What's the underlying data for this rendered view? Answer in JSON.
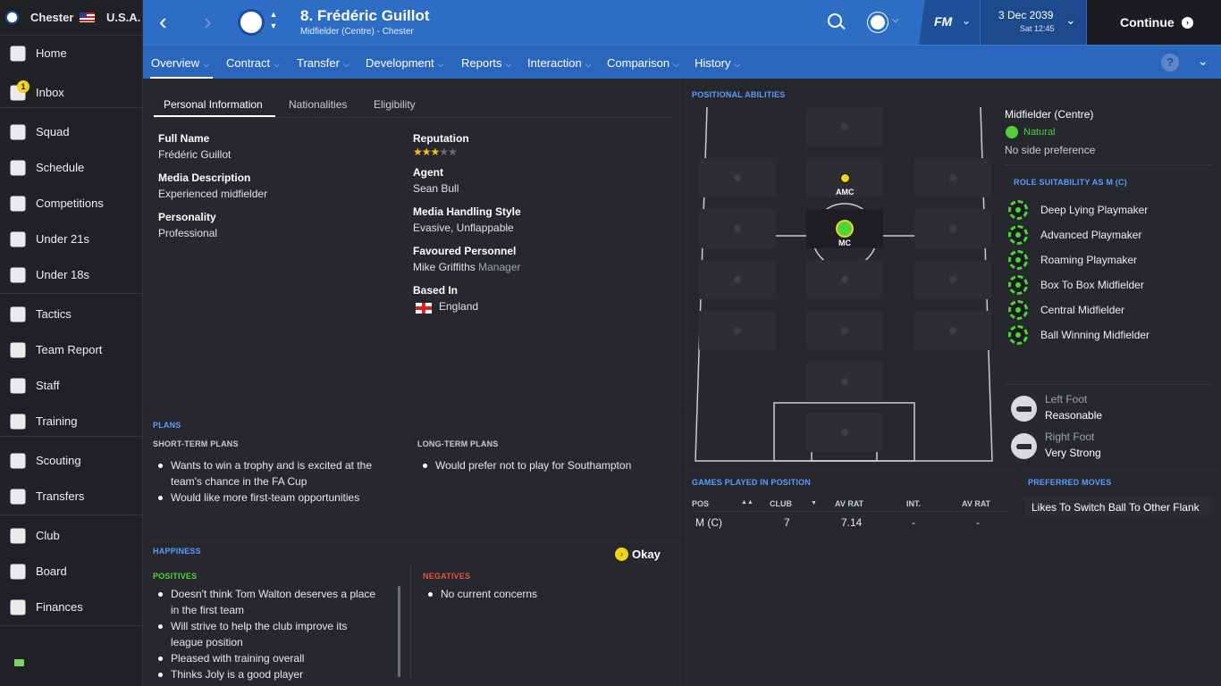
{
  "sidebar": {
    "club": "Chester",
    "nation": "U.S.A.",
    "inbox_badge": "1",
    "items": [
      {
        "label": "Home",
        "icon": "home-icon"
      },
      {
        "label": "Inbox",
        "icon": "inbox-icon"
      },
      {
        "label": "Squad",
        "icon": "squad-icon"
      },
      {
        "label": "Schedule",
        "icon": "calendar-icon"
      },
      {
        "label": "Competitions",
        "icon": "trophy-icon"
      },
      {
        "label": "Under 21s",
        "icon": "u21-icon"
      },
      {
        "label": "Under 18s",
        "icon": "u18-icon"
      },
      {
        "label": "Tactics",
        "icon": "tactics-icon"
      },
      {
        "label": "Team Report",
        "icon": "report-icon"
      },
      {
        "label": "Staff",
        "icon": "staff-icon"
      },
      {
        "label": "Training",
        "icon": "training-icon"
      },
      {
        "label": "Scouting",
        "icon": "search-icon"
      },
      {
        "label": "Transfers",
        "icon": "transfers-icon"
      },
      {
        "label": "Club",
        "icon": "club-icon"
      },
      {
        "label": "Board",
        "icon": "board-icon"
      },
      {
        "label": "Finances",
        "icon": "pound-icon"
      }
    ]
  },
  "header": {
    "player_title": "8. Frédéric Guillot",
    "player_subtitle": "Midfielder (Centre) - Chester",
    "fm_logo": "FM",
    "date": "3 Dec 2039",
    "time": "Sat 12:45",
    "continue_label": "Continue"
  },
  "tabs": [
    "Overview",
    "Contract",
    "Transfer",
    "Development",
    "Reports",
    "Interaction",
    "Comparison",
    "History"
  ],
  "subtabs": [
    "Personal Information",
    "Nationalities",
    "Eligibility"
  ],
  "personal": {
    "full_name_label": "Full Name",
    "full_name": "Frédéric Guillot",
    "media_desc_label": "Media Description",
    "media_desc": "Experienced midfielder",
    "personality_label": "Personality",
    "personality": "Professional",
    "reputation_label": "Reputation",
    "reputation_stars": 3,
    "agent_label": "Agent",
    "agent": "Sean Bull",
    "media_style_label": "Media Handling Style",
    "media_style": "Evasive, Unflappable",
    "fav_label": "Favoured Personnel",
    "fav_name": "Mike Griffiths",
    "fav_role": "Manager",
    "based_label": "Based In",
    "based": "England"
  },
  "plans": {
    "title": "PLANS",
    "short_title": "SHORT-TERM PLANS",
    "short": [
      "Wants to win a trophy and is excited at the",
      "team's chance in the FA Cup",
      "Would like more first-team opportunities"
    ],
    "long_title": "LONG-TERM PLANS",
    "long": [
      "Would prefer not to play for Southampton"
    ]
  },
  "happiness": {
    "title": "HAPPINESS",
    "status": "Okay",
    "positives_title": "POSITIVES",
    "positives": [
      "Doesn't think Tom Walton deserves a place",
      "in the first team",
      "Will strive to help the club improve its",
      "league position",
      "Pleased with training overall",
      "Thinks Joly is a good player"
    ],
    "negatives_title": "NEGATIVES",
    "negatives": [
      "No current concerns"
    ]
  },
  "positional": {
    "title": "POSITIONAL ABILITIES",
    "amc": "AMC",
    "mc": "MC",
    "position_name": "Midfielder (Centre)",
    "rating": "Natural",
    "side_pref": "No side preference",
    "roles_title": "ROLE SUITABILITY AS M (C)",
    "roles": [
      "Deep Lying Playmaker",
      "Advanced Playmaker",
      "Roaming Playmaker",
      "Box To Box Midfielder",
      "Central Midfielder",
      "Ball Winning Midfielder"
    ],
    "left_foot_label": "Left Foot",
    "left_foot": "Reasonable",
    "right_foot_label": "Right Foot",
    "right_foot": "Very Strong"
  },
  "games": {
    "title": "GAMES PLAYED IN POSITION",
    "headers": [
      "POS",
      "CLUB",
      "AV RAT",
      "INT.",
      "AV RAT"
    ],
    "row": [
      "M (C)",
      "7",
      "7.14",
      "-",
      "-"
    ]
  },
  "moves": {
    "title": "PREFERRED MOVES",
    "items": [
      "Likes To Switch Ball To Other Flank"
    ]
  },
  "colors": {
    "header": "#2e6dc4",
    "accent": "#5b9bff",
    "natural": "#4fd13a"
  }
}
